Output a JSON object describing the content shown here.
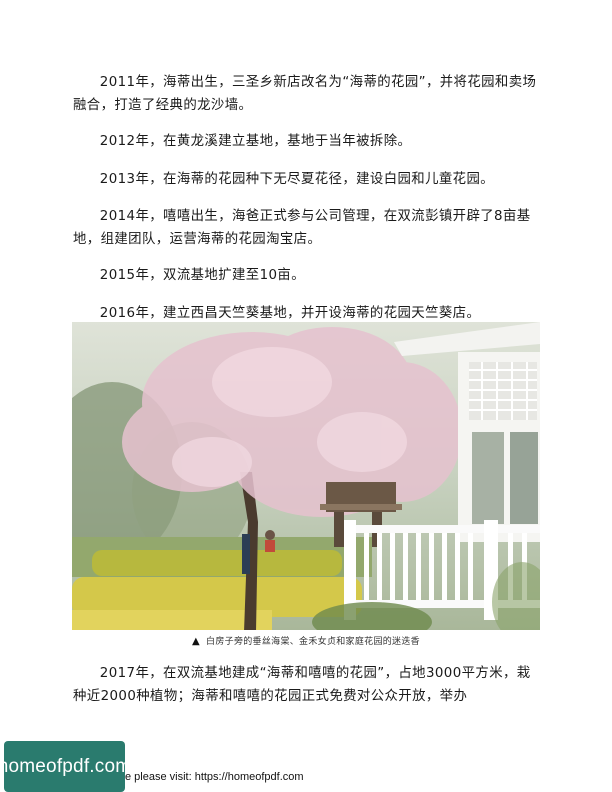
{
  "paragraphs": {
    "p1": "2011年，海蒂出生，三圣乡新店改名为“海蒂的花园”，并将花园和卖场融合，打造了经典的龙沙墙。",
    "p2": "2012年，在黄龙溪建立基地，基地于当年被拆除。",
    "p3": "2013年，在海蒂的花园种下无尽夏花径，建设白园和儿童花园。",
    "p4": "2014年，嘻嘻出生，海爸正式参与公司管理，在双流彭镇开辟了8亩基地，组建团队，运营海蒂的花园淘宝店。",
    "p5": "2015年，双流基地扩建至10亩。",
    "p6": "2016年，建立西昌天竺葵基地，并开设海蒂的花园天竺葵店。",
    "p7": "2017年，在双流基地建成“海蒂和嘻嘻的花园”，占地3000平方米，栽种近2000种植物；海蒂和嘻嘻的花园正式免费对公众开放，举办"
  },
  "figure": {
    "caption_marker": "▲",
    "caption": "白房子旁的垂丝海棠、金禾女贞和家庭花园的迷迭香"
  },
  "watermark": {
    "logo_text": "homeofpdf.com",
    "footer_text": "e please visit: https://homeofpdf.com"
  }
}
